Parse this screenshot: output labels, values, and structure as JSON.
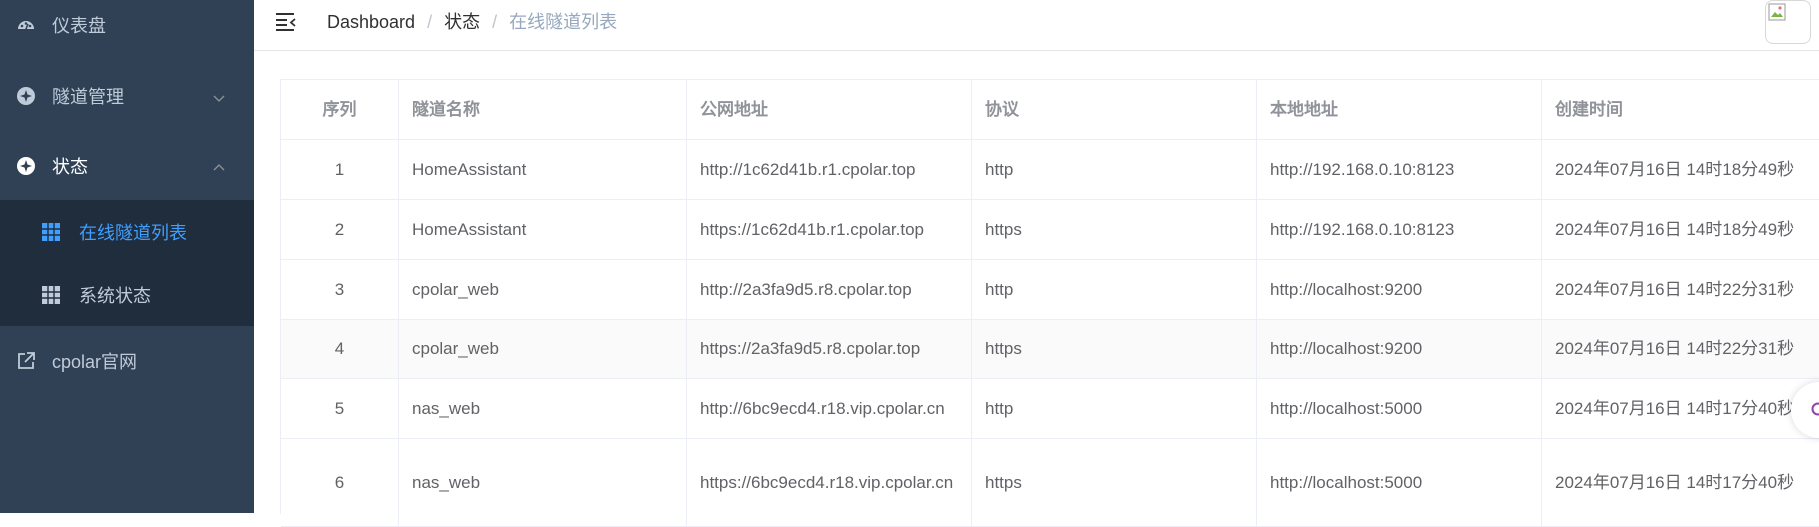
{
  "sidebar": {
    "items": [
      {
        "label": "仪表盘",
        "icon": "dashboard-icon"
      },
      {
        "label": "隧道管理",
        "icon": "tunnel-icon"
      },
      {
        "label": "状态",
        "icon": "status-icon"
      },
      {
        "label": "cpolar官网",
        "icon": "external-link-icon"
      }
    ],
    "subitems": [
      {
        "label": "在线隧道列表",
        "icon": "grid-icon",
        "active": true
      },
      {
        "label": "系统状态",
        "icon": "grid-icon",
        "active": false
      }
    ]
  },
  "header": {
    "breadcrumb": [
      "Dashboard",
      "状态",
      "在线隧道列表"
    ],
    "separator": "/"
  },
  "table": {
    "columns": [
      "序列",
      "隧道名称",
      "公网地址",
      "协议",
      "本地地址",
      "创建时间"
    ],
    "rows": [
      [
        "1",
        "HomeAssistant",
        "http://1c62d41b.r1.cpolar.top",
        "http",
        "http://192.168.0.10:8123",
        "2024年07月16日 14时18分49秒"
      ],
      [
        "2",
        "HomeAssistant",
        "https://1c62d41b.r1.cpolar.top",
        "https",
        "http://192.168.0.10:8123",
        "2024年07月16日 14时18分49秒"
      ],
      [
        "3",
        "cpolar_web",
        "http://2a3fa9d5.r8.cpolar.top",
        "http",
        "http://localhost:9200",
        "2024年07月16日 14时22分31秒"
      ],
      [
        "4",
        "cpolar_web",
        "https://2a3fa9d5.r8.cpolar.top",
        "https",
        "http://localhost:9200",
        "2024年07月16日 14时22分31秒"
      ],
      [
        "5",
        "nas_web",
        "http://6bc9ecd4.r18.vip.cpolar.cn",
        "http",
        "http://localhost:5000",
        "2024年07月16日 14时17分40秒"
      ],
      [
        "6",
        "nas_web",
        "https://6bc9ecd4.r18.vip.cpolar.cn",
        "https",
        "http://localhost:5000",
        "2024年07月16日 14时17分40秒"
      ]
    ]
  },
  "colors": {
    "sidebar_bg": "#304156",
    "submenu_bg": "#1f2d3d",
    "active": "#409eff",
    "menu_text": "#bfcbd9"
  }
}
